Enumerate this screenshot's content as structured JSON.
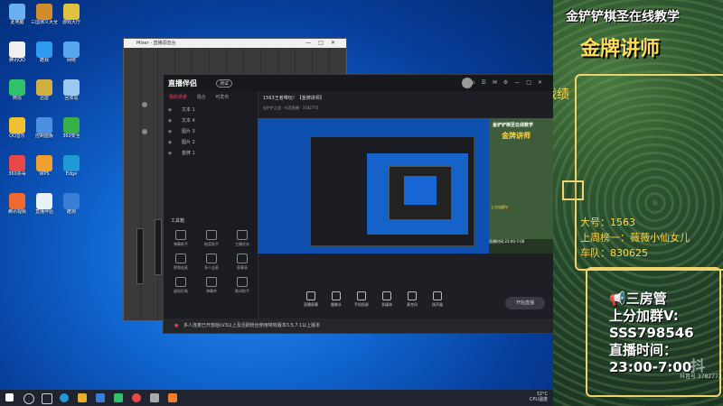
{
  "desktop": {
    "icons": [
      {
        "label": "此电脑",
        "color": "#6ab0f0"
      },
      {
        "label": "三国演义大全",
        "color": "#d38c2c"
      },
      {
        "label": "游戏大厅",
        "color": "#e0c040"
      },
      {
        "label": "腾讯QQ",
        "color": "#f0f0f0"
      },
      {
        "label": "酷我",
        "color": "#2e9af0"
      },
      {
        "label": "网络",
        "color": "#55a8f0"
      },
      {
        "label": "微信",
        "color": "#2ec26a"
      },
      {
        "label": "迅雷",
        "color": "#d0b040"
      },
      {
        "label": "回收站",
        "color": "#9ac8f0"
      },
      {
        "label": "QQ音乐",
        "color": "#f0c030"
      },
      {
        "label": "控制面板",
        "color": "#4a90e0"
      },
      {
        "label": "360安全",
        "color": "#38b048"
      },
      {
        "label": "360杀毒",
        "color": "#e84848"
      },
      {
        "label": "WPS",
        "color": "#f0a030"
      },
      {
        "label": "Edge",
        "color": "#1e9ad6"
      },
      {
        "label": "腾讯视频",
        "color": "#f06a30"
      },
      {
        "label": "直播伴侣",
        "color": "#e8f0f8"
      },
      {
        "label": "酷狗",
        "color": "#3a7ed8"
      }
    ]
  },
  "mixer": {
    "title": "Mixer - 直播调音台"
  },
  "app": {
    "logo": "直播伴侣",
    "badge": "测试",
    "tabs": [
      "我的场景",
      "混合",
      "可发布"
    ],
    "scenes": [
      "文本 1",
      "文本 4",
      "图片 3",
      "图片 2",
      "金牌 1"
    ],
    "tools_title": "工具箱",
    "tools": [
      "弹幕助手",
      "抽奖助手",
      "主播任务",
      "视频连麦",
      "多人连麦",
      "屏幕录",
      "虚拟形象",
      "弹幕库",
      "歌词助手"
    ],
    "room_title": "1563王者带玩！【金牌讲师】",
    "room_sub": "金铲铲之战 · 抖音直播 · 3782773",
    "bottom_tools": [
      "直播屏幕",
      "摄像头",
      "手机投屏",
      "多媒体",
      "麦克风",
      "扬声器"
    ],
    "golive": "开始直播",
    "status": "多人连麦已开放给LV3以上及活跃粉丝使用特效版本3.5.7.1以上版本"
  },
  "preview_thumb": {
    "line1": "金铲铲棋圣在线教学",
    "line2": "金牌讲师",
    "line3": "上分加群V:",
    "box": "直播时间:23:00-7:00"
  },
  "overlay": {
    "title": "金铲铲棋圣在线教学",
    "main": "金牌讲师",
    "war": "战绩",
    "info": [
      "大号：1563",
      "上周榜一：薇薇小仙女儿",
      "车队：830625"
    ],
    "notice_title": "三房管",
    "notice_lines": [
      "上分加群V:",
      "SSS798546",
      "直播时间：",
      "23:00-7:00"
    ],
    "watermark": "抖音号 3782773",
    "watermark_logo": "抖"
  },
  "taskbar": {
    "tray_line1": "32°C",
    "tray_line2": "CPU温度"
  },
  "colors": {
    "accent": "#f2405a",
    "gold": "#ffd54a",
    "frame": "#f0d36a"
  }
}
